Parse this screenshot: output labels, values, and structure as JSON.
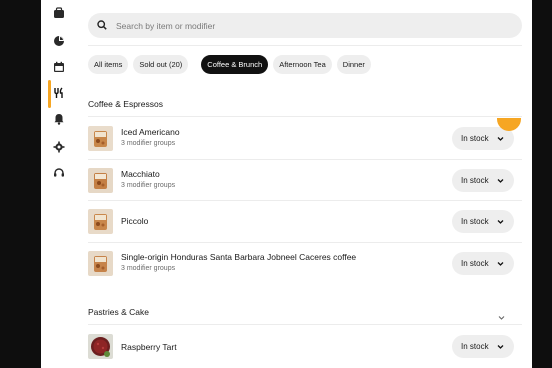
{
  "search": {
    "placeholder": "Search by item or modifier"
  },
  "filters": [
    {
      "label": "All items",
      "active": false
    },
    {
      "label": "Sold out (20)",
      "active": false
    },
    {
      "label": "Coffee & Brunch",
      "active": true
    },
    {
      "label": "Afternoon Tea",
      "active": false
    },
    {
      "label": "Dinner",
      "active": false
    }
  ],
  "sidebar": {
    "items": [
      {
        "icon": "store-icon"
      },
      {
        "icon": "chart-icon"
      },
      {
        "icon": "calendar-icon"
      },
      {
        "icon": "menu-icon",
        "active": true
      },
      {
        "icon": "bell-icon"
      },
      {
        "icon": "gear-icon"
      },
      {
        "icon": "support-icon"
      }
    ],
    "accent": "#f6a623"
  },
  "sections": [
    {
      "title": "Coffee & Espressos",
      "items": [
        {
          "name": "Iced Americano",
          "sub": "3 modifier groups",
          "status": "In stock"
        },
        {
          "name": "Macchiato",
          "sub": "3 modifier groups",
          "status": "In stock"
        },
        {
          "name": "Piccolo",
          "sub": "",
          "status": "In stock"
        },
        {
          "name": "Single-origin Honduras Santa Barbara Jobneel Caceres coffee",
          "sub": "3 modifier groups",
          "status": "In stock"
        }
      ]
    },
    {
      "title": "Pastries & Cake",
      "items": [
        {
          "name": "Raspberry Tart",
          "sub": "",
          "status": "In stock"
        }
      ]
    }
  ]
}
